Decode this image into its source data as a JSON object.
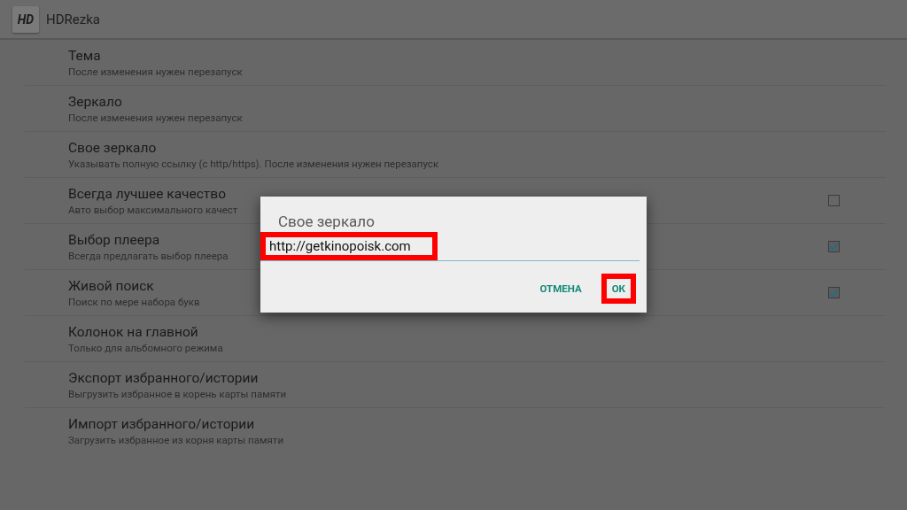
{
  "app_bar": {
    "logo": "HD",
    "title": "HDRezka"
  },
  "settings": [
    {
      "kind": "plain",
      "title": "Тема",
      "subtitle": "После изменения нужен перезапуск"
    },
    {
      "kind": "plain",
      "title": "Зеркало",
      "subtitle": "После изменения нужен перезапуск"
    },
    {
      "kind": "plain",
      "title": "Свое зеркало",
      "subtitle": "Указывать полную ссылку (с http/https). После изменения нужен перезапуск"
    },
    {
      "kind": "checkbox",
      "title": "Всегда лучшее качество",
      "subtitle": "Авто выбор максимального качест",
      "checked": false
    },
    {
      "kind": "checkbox",
      "title": "Выбор плеера",
      "subtitle": "Всегда предлагать выбор плеера",
      "checked": true
    },
    {
      "kind": "checkbox",
      "title": "Живой поиск",
      "subtitle": "Поиск по мере набора букв",
      "checked": true
    },
    {
      "kind": "plain",
      "title": "Колонок на главной",
      "subtitle": "Только для альбомного режима"
    },
    {
      "kind": "plain",
      "title": "Экспорт избранного/истории",
      "subtitle": "Выгрузить избранное в корень карты памяти"
    },
    {
      "kind": "plain",
      "title": "Импорт избранного/истории",
      "subtitle": "Загрузить избранное из корня карты памяти"
    }
  ],
  "dialog": {
    "title": "Свое зеркало",
    "value": "http://getkinopoisk.com",
    "buttons": [
      {
        "label": "ОТМЕНА",
        "highlighted": false
      },
      {
        "label": "ОК",
        "highlighted": true
      }
    ]
  }
}
